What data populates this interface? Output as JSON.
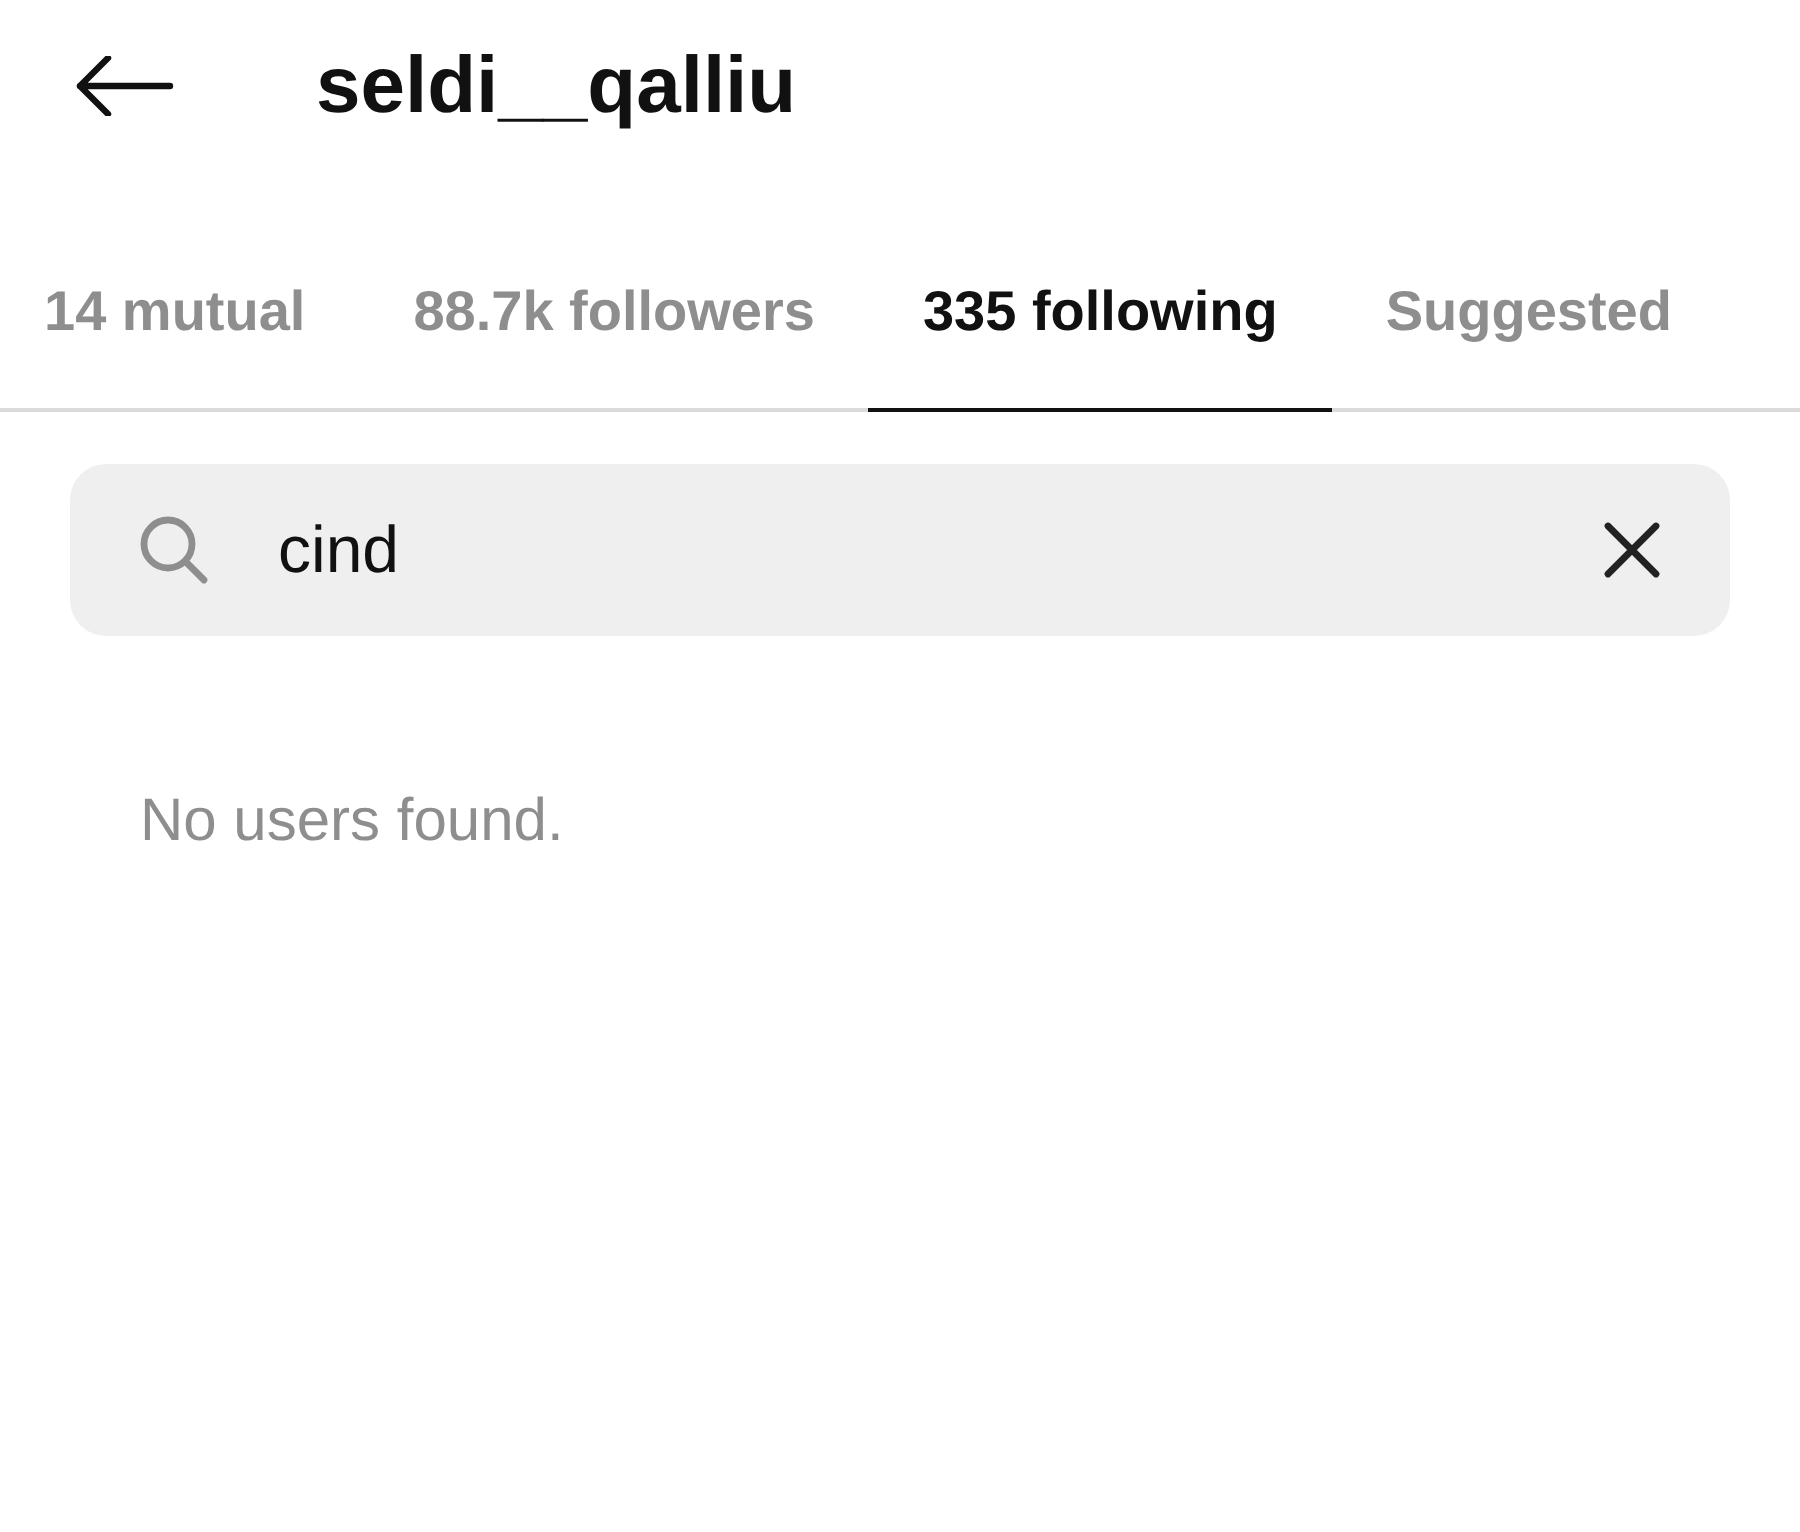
{
  "header": {
    "title": "seldi__qalliu"
  },
  "tabs": [
    {
      "label": "14 mutual",
      "selected": false
    },
    {
      "label": "88.7k followers",
      "selected": false
    },
    {
      "label": "335 following",
      "selected": true
    },
    {
      "label": "Suggested",
      "selected": false
    }
  ],
  "search": {
    "value": "cind"
  },
  "empty_message": "No users found."
}
